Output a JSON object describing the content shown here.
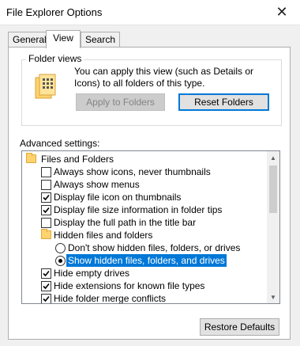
{
  "window": {
    "title": "File Explorer Options",
    "close_glyph": "✕"
  },
  "tabs": [
    {
      "label": "General"
    },
    {
      "label": "View"
    },
    {
      "label": "Search"
    }
  ],
  "folder_views": {
    "label": "Folder views",
    "description": "You can apply this view (such as Details or Icons) to all folders of this type.",
    "apply_button": "Apply to Folders",
    "reset_button": "Reset Folders"
  },
  "advanced": {
    "label": "Advanced settings:",
    "items": [
      {
        "type": "folder",
        "label": "Files and Folders"
      },
      {
        "type": "checkbox",
        "label": "Always show icons, never thumbnails",
        "checked": false
      },
      {
        "type": "checkbox",
        "label": "Always show menus",
        "checked": false
      },
      {
        "type": "checkbox",
        "label": "Display file icon on thumbnails",
        "checked": true
      },
      {
        "type": "checkbox",
        "label": "Display file size information in folder tips",
        "checked": true
      },
      {
        "type": "checkbox",
        "label": "Display the full path in the title bar",
        "checked": false
      },
      {
        "type": "folder",
        "label": "Hidden files and folders"
      },
      {
        "type": "radio",
        "label": "Don't show hidden files, folders, or drives",
        "checked": false
      },
      {
        "type": "radio",
        "label": "Show hidden files, folders, and drives",
        "checked": true,
        "selected": true
      },
      {
        "type": "checkbox",
        "label": "Hide empty drives",
        "checked": true
      },
      {
        "type": "checkbox",
        "label": "Hide extensions for known file types",
        "checked": true
      },
      {
        "type": "checkbox",
        "label": "Hide folder merge conflicts",
        "checked": true
      }
    ]
  },
  "restore_button": "Restore Defaults",
  "colors": {
    "accent": "#0078d7",
    "folder": "#ffd36e"
  }
}
